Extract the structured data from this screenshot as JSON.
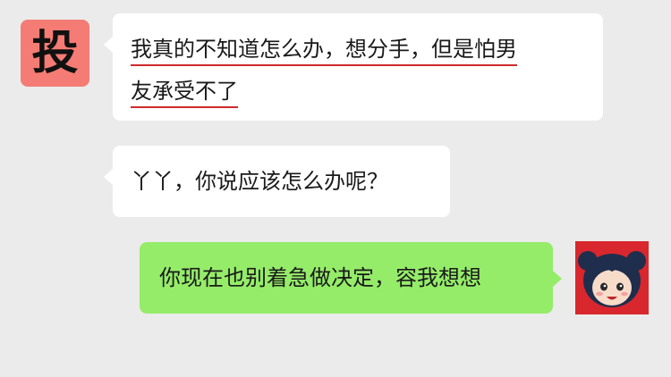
{
  "avatars": {
    "left": {
      "text": "投",
      "color": "#f47c74",
      "icon": "text-avatar"
    },
    "right": {
      "icon": "cartoon-girl-avatar",
      "color": "#d8272d"
    }
  },
  "messages": [
    {
      "side": "left",
      "lines": [
        "我真的不知道怎么办，想分手，但是怕男",
        "友承受不了"
      ],
      "underline_color": "#cf2a2a"
    },
    {
      "side": "left",
      "text": "丫丫，你说应该怎么办呢？"
    },
    {
      "side": "right",
      "text": "你现在也别着急做决定，容我想想",
      "color": "#95ec69"
    }
  ]
}
